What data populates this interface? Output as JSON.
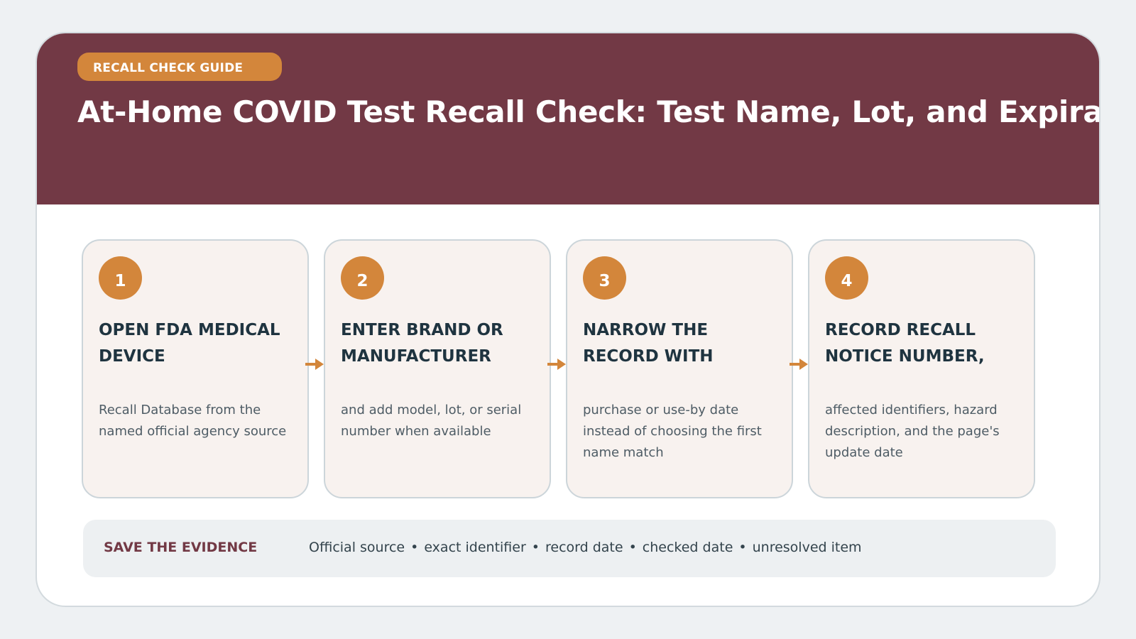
{
  "header": {
    "tag": "RECALL CHECK GUIDE",
    "title": "At-Home COVID Test Recall Check: Test Name, Lot, and Expiration"
  },
  "steps": [
    {
      "number": "1",
      "title": "OPEN FDA MEDICAL DEVICE",
      "description": "Recall Database from the named official agency source"
    },
    {
      "number": "2",
      "title": "ENTER BRAND OR MANUFACTURER",
      "description": "and add model, lot, or serial number when available"
    },
    {
      "number": "3",
      "title": "NARROW THE RECORD WITH",
      "description": "purchase or use-by date instead of choosing the first name match"
    },
    {
      "number": "4",
      "title": "RECORD RECALL NOTICE NUMBER,",
      "description": "affected identifiers, hazard description, and the page's update date"
    }
  ],
  "footer": {
    "label": "SAVE THE EVIDENCE",
    "items": [
      "Official source",
      "exact identifier",
      "record date",
      "checked date",
      "unresolved item"
    ],
    "separator": "•"
  },
  "colors": {
    "header_bg": "#723945",
    "accent": "#d3863b",
    "step_bg": "#f8f2ef",
    "heading_text": "#1f3440"
  }
}
